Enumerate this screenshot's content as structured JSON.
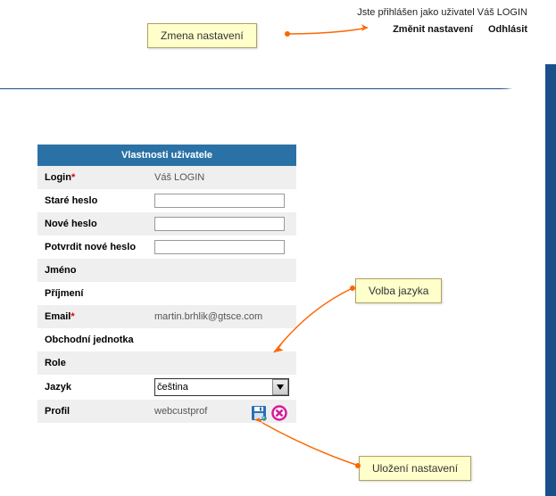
{
  "header": {
    "status_prefix": "Jste přihlášen jako uživatel ",
    "user_login": "Váš LOGIN",
    "change_settings": "Změnit nastavení",
    "logout": "Odhlásit"
  },
  "form": {
    "title": "Vlastnosti uživatele",
    "login_label": "Login",
    "login_value": "Váš LOGIN",
    "old_pw_label": "Staré heslo",
    "new_pw_label": "Nové heslo",
    "confirm_pw_label": "Potvrdit nové heslo",
    "firstname_label": "Jméno",
    "lastname_label": "Příjmení",
    "email_label": "Email",
    "email_value": "martin.brhlik@gtsce.com",
    "bu_label": "Obchodní jednotka",
    "role_label": "Role",
    "lang_label": "Jazyk",
    "lang_value": "čeština",
    "profile_label": "Profil",
    "profile_value": "webcustprof"
  },
  "callouts": {
    "settings": "Zmena nastavení",
    "language": "Volba jazyka",
    "save": "Uložení nastavení"
  },
  "colors": {
    "navy": "#1b4f8a",
    "accent": "#ff6600",
    "callout_bg": "#ffffcc"
  },
  "asterisk": "*"
}
